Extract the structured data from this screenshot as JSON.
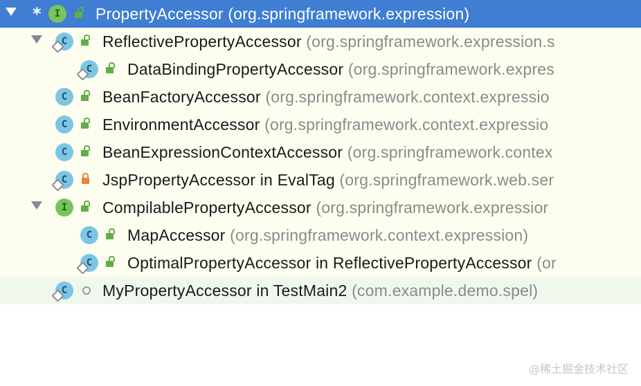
{
  "tree": {
    "rows": [
      {
        "name": "PropertyAccessor",
        "in": "",
        "pkg": "(org.springframework.expression)",
        "kind": "interface",
        "access": "public",
        "star": "*",
        "expanded": true,
        "selected": true
      },
      {
        "name": "ReflectivePropertyAccessor",
        "in": "",
        "pkg": "(org.springframework.expression.s",
        "kind": "class",
        "access": "public",
        "expanded": true
      },
      {
        "name": "DataBindingPropertyAccessor",
        "in": "",
        "pkg": "(org.springframework.expres",
        "kind": "class",
        "access": "public"
      },
      {
        "name": "BeanFactoryAccessor",
        "in": "",
        "pkg": "(org.springframework.context.expressio",
        "kind": "class",
        "access": "public"
      },
      {
        "name": "EnvironmentAccessor",
        "in": "",
        "pkg": "(org.springframework.context.expressio",
        "kind": "class",
        "access": "public"
      },
      {
        "name": "BeanExpressionContextAccessor",
        "in": "",
        "pkg": "(org.springframework.contex",
        "kind": "class",
        "access": "public"
      },
      {
        "name": "JspPropertyAccessor",
        "in": " in EvalTag",
        "pkg": "(org.springframework.web.ser",
        "kind": "class",
        "access": "private"
      },
      {
        "name": "CompilablePropertyAccessor",
        "in": "",
        "pkg": "(org.springframework.expressior",
        "kind": "interface",
        "access": "public",
        "expanded": true
      },
      {
        "name": "MapAccessor",
        "in": "",
        "pkg": "(org.springframework.context.expression)",
        "kind": "class",
        "access": "public"
      },
      {
        "name": "OptimalPropertyAccessor",
        "in": " in ReflectivePropertyAccessor",
        "pkg": "(or",
        "kind": "class",
        "access": "public"
      },
      {
        "name": "MyPropertyAccessor",
        "in": " in TestMain2",
        "pkg": "(com.example.demo.spel)",
        "kind": "class",
        "access": "package",
        "highlight": true
      }
    ]
  },
  "icons": {
    "class_letter": "C",
    "interface_letter": "I"
  },
  "watermark": "@稀土掘金技术社区"
}
